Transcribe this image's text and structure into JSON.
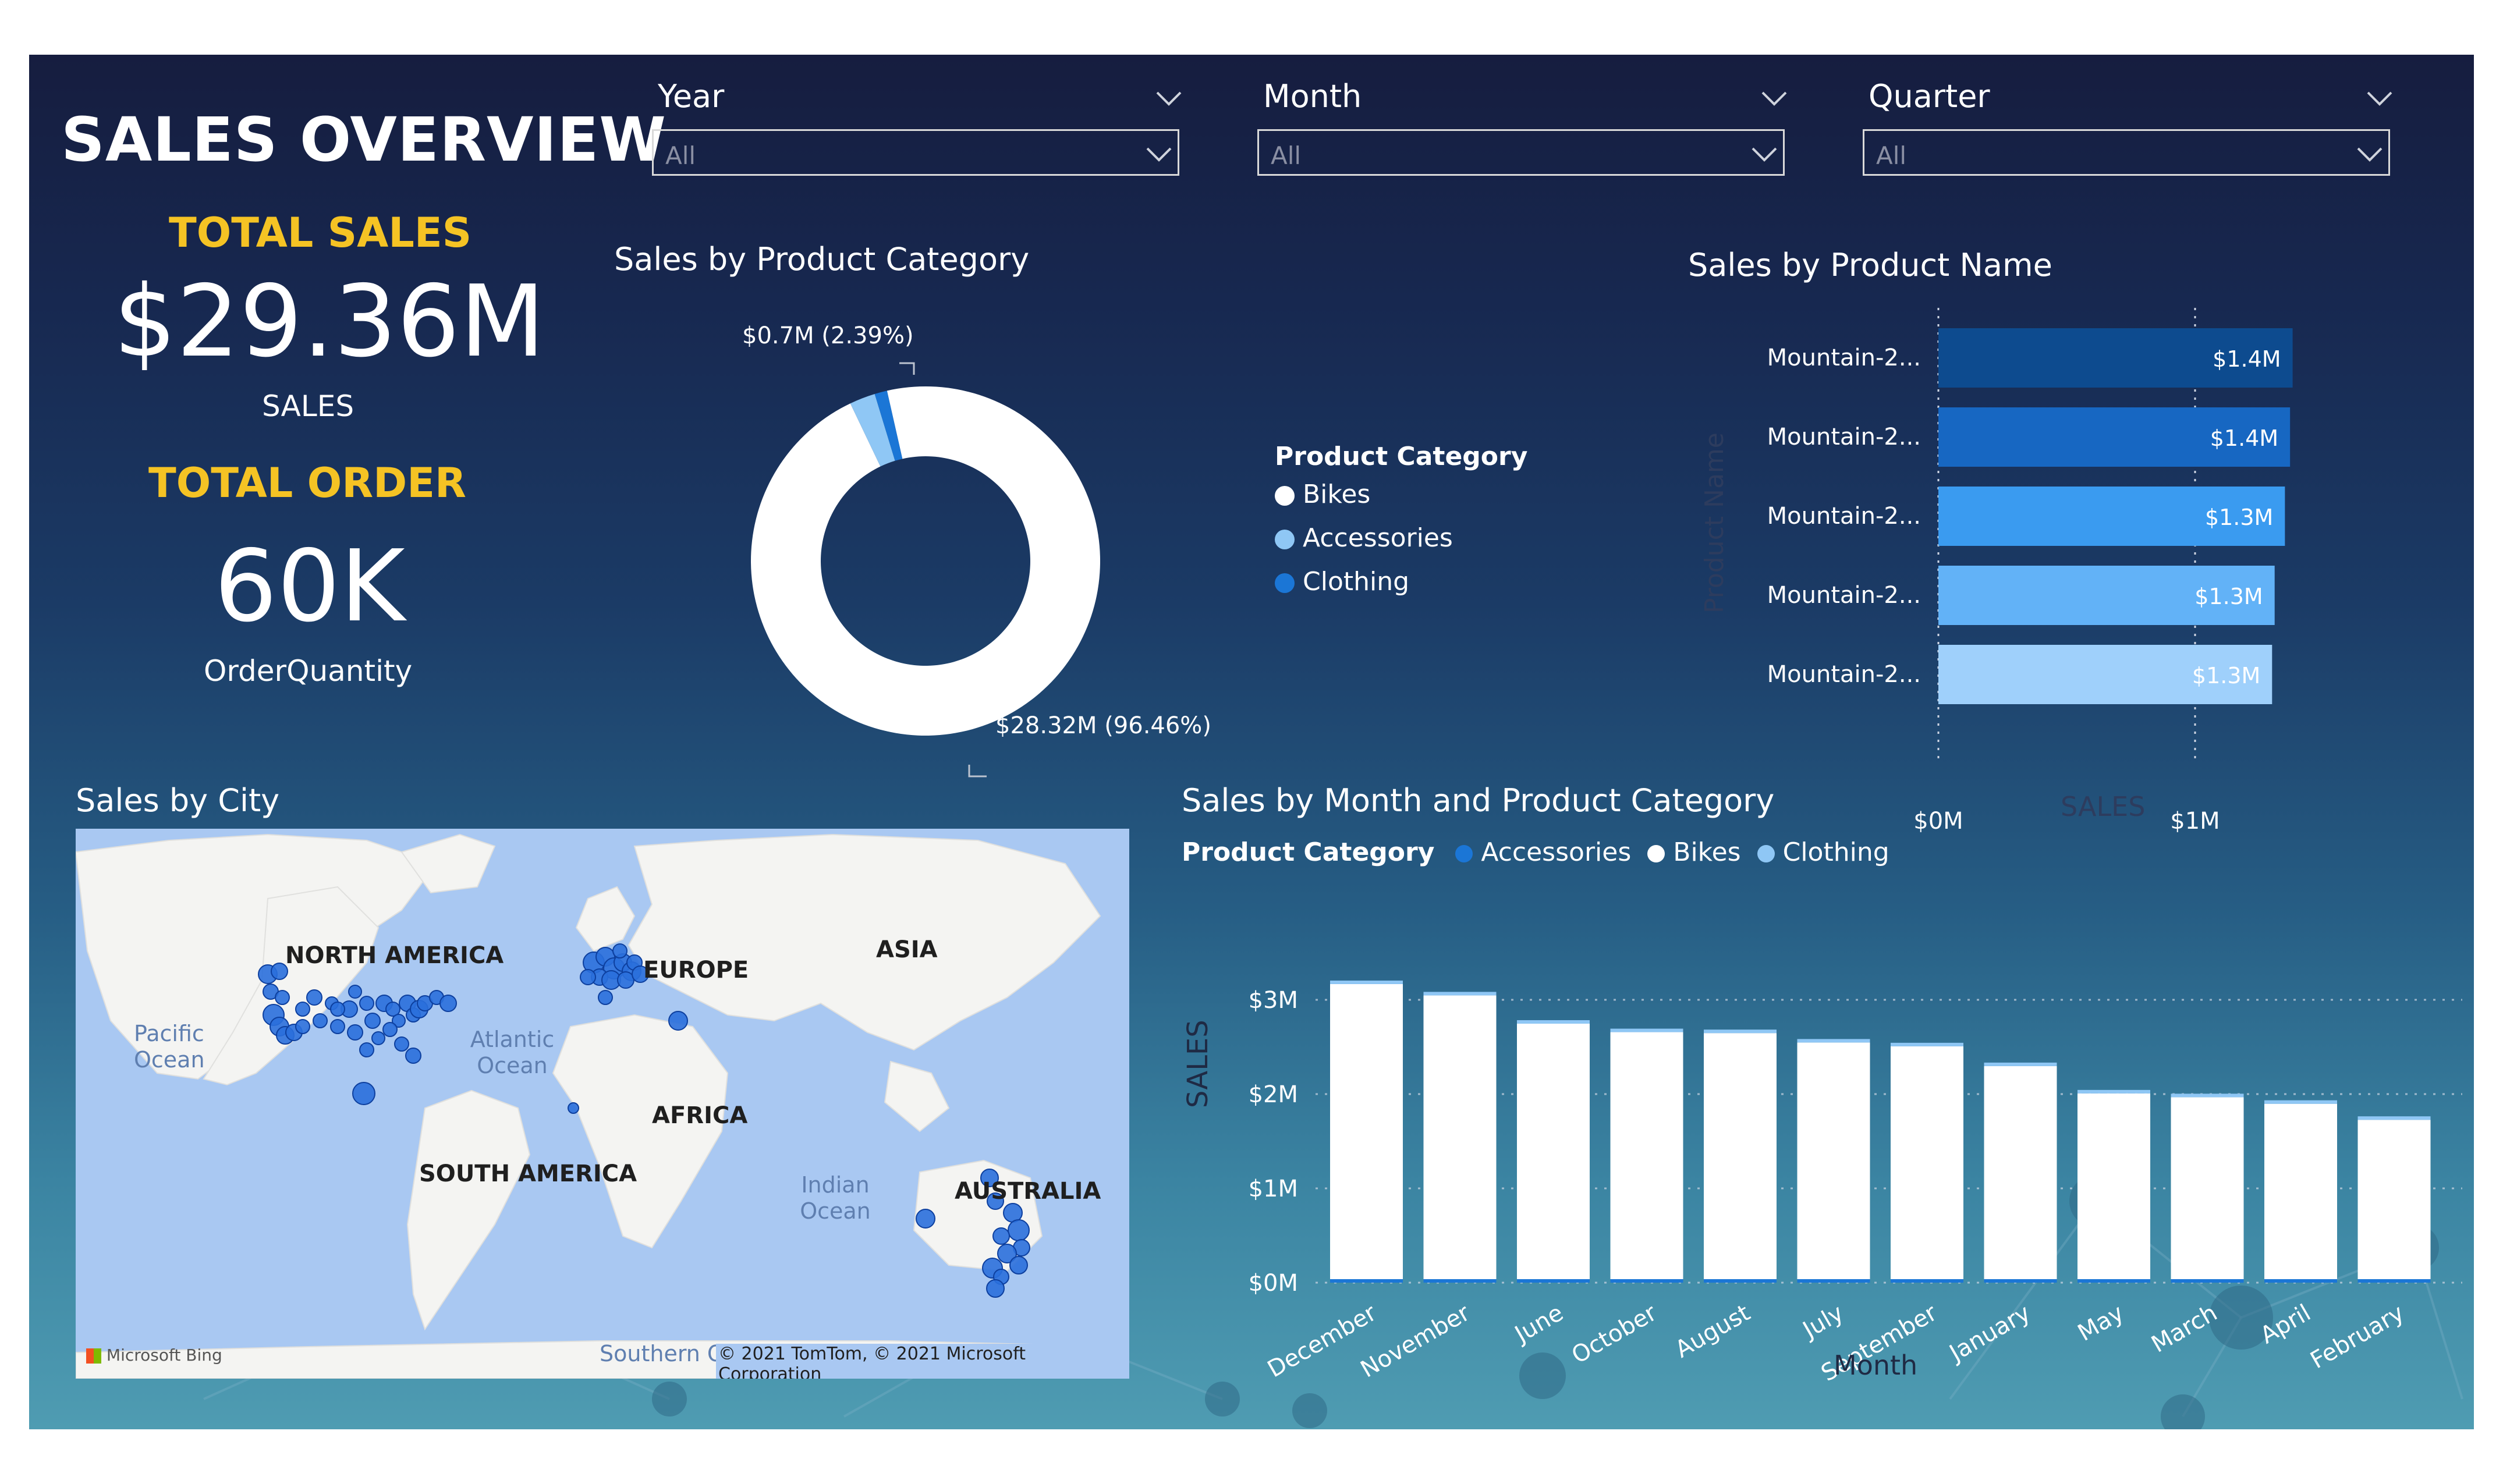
{
  "dashboard": {
    "title": "SALES OVERVIEW"
  },
  "kpis": {
    "total_sales": {
      "title": "TOTAL SALES",
      "value": "$29.36M",
      "label": "SALES"
    },
    "total_order": {
      "title": "TOTAL ORDER",
      "value": "60K",
      "label": "OrderQuantity"
    }
  },
  "slicers": [
    {
      "label": "Year",
      "value": "All"
    },
    {
      "label": "Month",
      "value": "All"
    },
    {
      "label": "Quarter",
      "value": "All"
    }
  ],
  "donut": {
    "title": "Sales by Product Category",
    "label_small": "$0.7M (2.39%)",
    "label_large": "$28.32M (96.46%)",
    "legend_title": "Product Category",
    "legend": [
      {
        "name": "Bikes",
        "color": "#ffffff"
      },
      {
        "name": "Accessories",
        "color": "#8fc7f5"
      },
      {
        "name": "Clothing",
        "color": "#1b76d6"
      }
    ]
  },
  "bars_h": {
    "title": "Sales by Product Name",
    "axis_y_label": "Product Name",
    "axis_x_label": "SALES",
    "ticks": [
      "$0M",
      "$1M"
    ]
  },
  "map": {
    "title": "Sales by City",
    "labels": {
      "north_america": "NORTH AMERICA",
      "europe": "EUROPE",
      "asia": "ASIA",
      "africa": "AFRICA",
      "south_america": "SOUTH AMERICA",
      "australia": "AUSTRALIA",
      "pacific": "Pacific Ocean",
      "atlantic": "Atlantic Ocean",
      "indian": "Indian Ocean",
      "southern": "Southern Ocean"
    },
    "attribution": "© 2021 TomTom, © 2021 Microsoft Corporation",
    "bing": "Microsoft Bing"
  },
  "monthly": {
    "title": "Sales by Month and Product Category",
    "legend_title": "Product Category",
    "legend": [
      {
        "name": "Accessories",
        "color": "#1b76d6"
      },
      {
        "name": "Bikes",
        "color": "#ffffff"
      },
      {
        "name": "Clothing",
        "color": "#8fc7f5"
      }
    ],
    "y_label": "SALES",
    "x_label": "Month"
  },
  "chart_data": [
    {
      "type": "pie",
      "title": "Sales by Product Category",
      "categories": [
        "Bikes",
        "Accessories",
        "Clothing"
      ],
      "values": [
        28.32,
        0.7,
        0.34
      ],
      "units": "$M",
      "donut": true
    },
    {
      "type": "bar",
      "orientation": "horizontal",
      "title": "Sales by Product Name",
      "categories": [
        "Mountain-2...",
        "Mountain-2...",
        "Mountain-2...",
        "Mountain-2...",
        "Mountain-2..."
      ],
      "values": [
        1.38,
        1.37,
        1.35,
        1.31,
        1.3
      ],
      "data_labels": [
        "$1.4M",
        "$1.4M",
        "$1.3M",
        "$1.3M",
        "$1.3M"
      ],
      "colors": [
        "#0d4b8f",
        "#1767c2",
        "#3a9bf0",
        "#62b2f7",
        "#9fd0fb"
      ],
      "xlabel": "SALES",
      "ylabel": "Product Name",
      "xlim": [
        0,
        1.4
      ],
      "ticks": [
        "$0M",
        "$1M"
      ]
    },
    {
      "type": "bar",
      "stacked": true,
      "title": "Sales by Month and Product Category",
      "categories": [
        "December",
        "November",
        "June",
        "October",
        "August",
        "July",
        "September",
        "January",
        "May",
        "March",
        "April",
        "February"
      ],
      "series": [
        {
          "name": "Accessories",
          "values": [
            0.03,
            0.03,
            0.03,
            0.03,
            0.03,
            0.03,
            0.03,
            0.02,
            0.02,
            0.02,
            0.02,
            0.02
          ]
        },
        {
          "name": "Bikes",
          "values": [
            3.13,
            3.01,
            2.71,
            2.62,
            2.61,
            2.51,
            2.47,
            2.26,
            1.97,
            1.93,
            1.86,
            1.69
          ]
        },
        {
          "name": "Clothing",
          "values": [
            0.02,
            0.02,
            0.02,
            0.02,
            0.02,
            0.02,
            0.02,
            0.02,
            0.02,
            0.02,
            0.02,
            0.01
          ]
        }
      ],
      "xlabel": "Month",
      "ylabel": "SALES",
      "ylim": [
        0,
        3.2
      ],
      "yticks": [
        "$0M",
        "$1M",
        "$2M",
        "$3M"
      ],
      "yticks_values": [
        0,
        1,
        2,
        3
      ]
    }
  ]
}
